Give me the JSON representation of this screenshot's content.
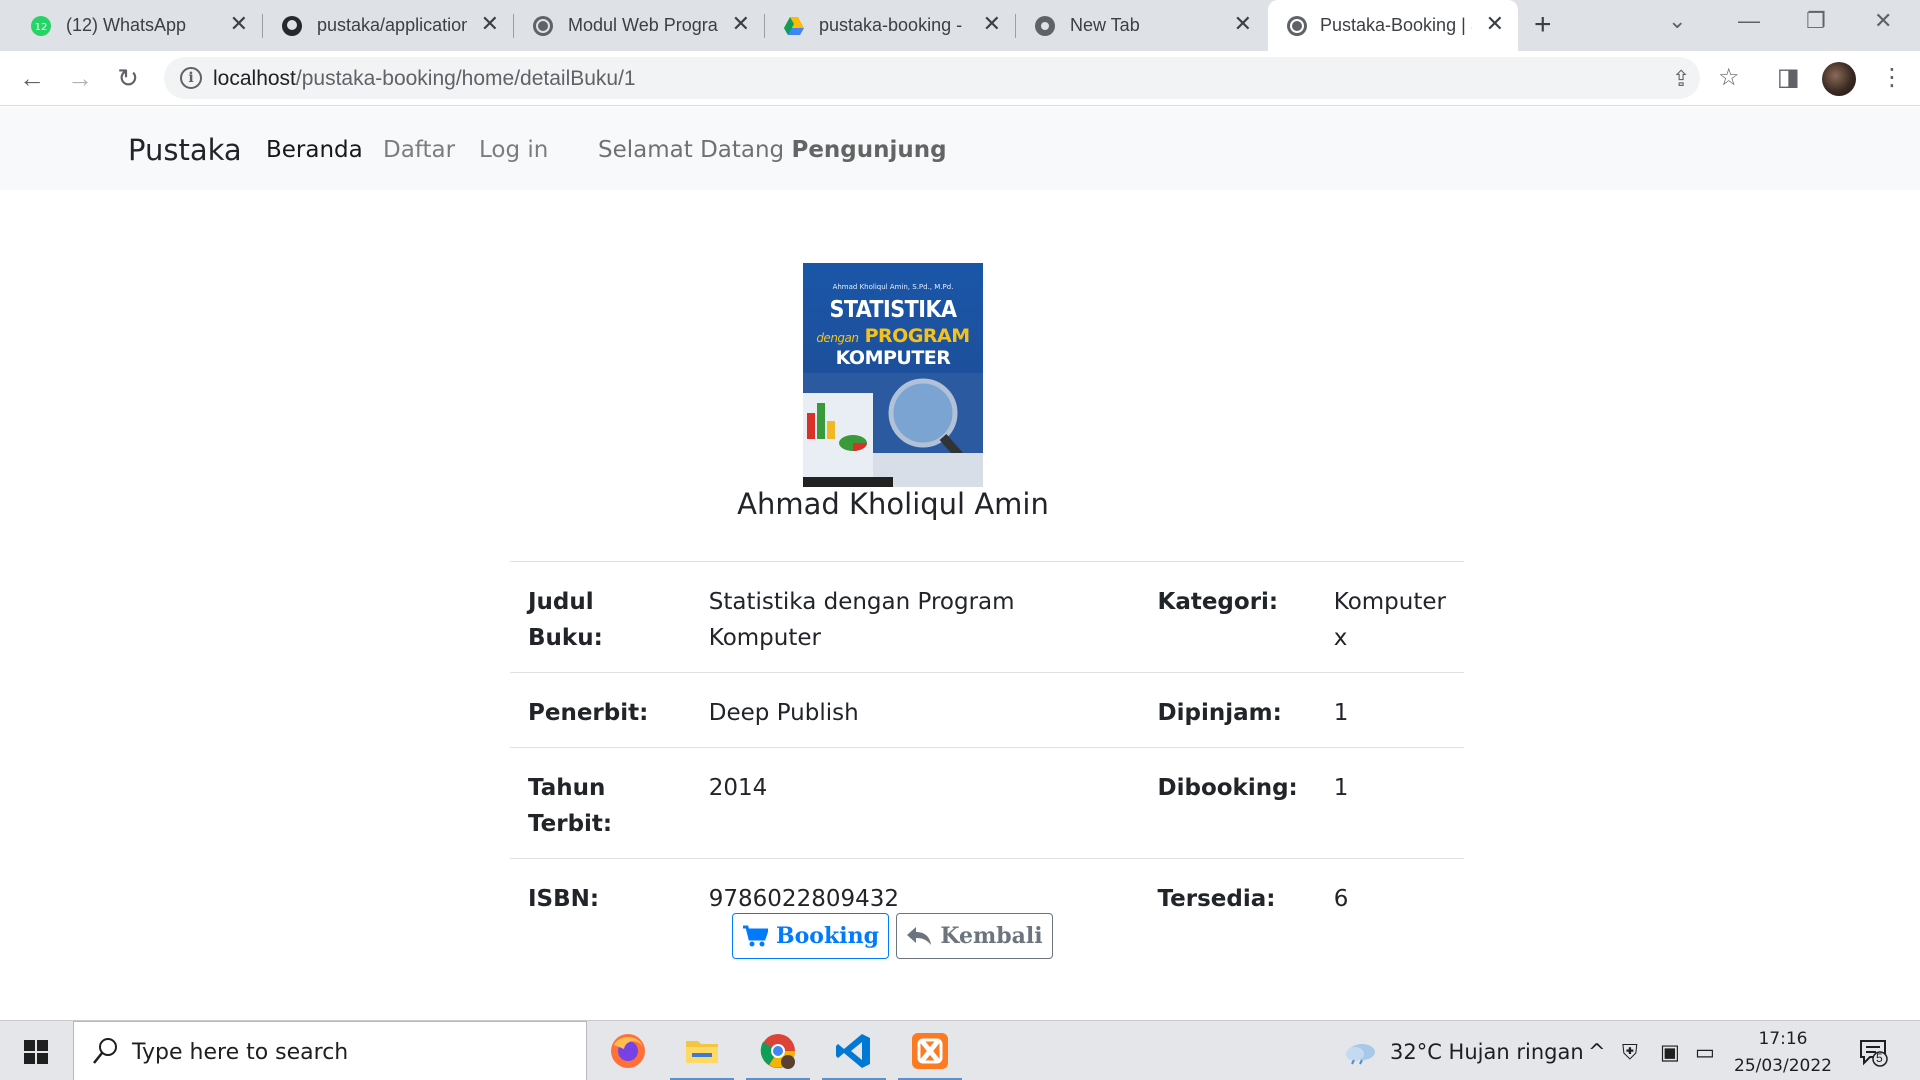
{
  "browser": {
    "tabs": [
      {
        "label": "(12) WhatsApp",
        "badge": "12"
      },
      {
        "label": "pustaka/application"
      },
      {
        "label": "Modul Web Progra"
      },
      {
        "label": "pustaka-booking - "
      },
      {
        "label": "New Tab"
      },
      {
        "label": "Pustaka-Booking | S"
      }
    ],
    "url_host": "localhost",
    "url_path": "/pustaka-booking/home/detailBuku/1"
  },
  "navbar": {
    "brand": "Pustaka",
    "links": [
      "Beranda",
      "Daftar",
      "Log in"
    ],
    "welcome_prefix": "Selamat Datang ",
    "welcome_user": "Pengunjung"
  },
  "book": {
    "cover": {
      "author_line": "Ahmad Kholiqul Amin, S.Pd., M.Pd.",
      "title_1": "STATISTIKA",
      "title_dengan": "dengan",
      "title_2": "PROGRAM",
      "title_3": "KOMPUTER"
    },
    "author": "Ahmad Kholiqul Amin",
    "rows": [
      {
        "l1": "Judul Buku:",
        "v1": "Statistika dengan Program Komputer",
        "l2": "Kategori:",
        "v2": "Komputer x"
      },
      {
        "l1": "Penerbit:",
        "v1": "Deep Publish",
        "l2": "Dipinjam:",
        "v2": "1"
      },
      {
        "l1": "Tahun Terbit:",
        "v1": "2014",
        "l2": "Dibooking:",
        "v2": "1"
      },
      {
        "l1": "ISBN:",
        "v1": "9786022809432",
        "l2": "Tersedia:",
        "v2": "6"
      }
    ],
    "buttons": {
      "booking": "Booking",
      "kembali": "Kembali"
    }
  },
  "taskbar": {
    "search_placeholder": "Type here to search",
    "weather": "32°C  Hujan ringan",
    "time": "17:16",
    "date": "25/03/2022",
    "notification_count": "5"
  },
  "colors": {
    "primary": "#007bff",
    "secondary": "#6c757d",
    "navbar_bg": "#f8f9fa"
  }
}
